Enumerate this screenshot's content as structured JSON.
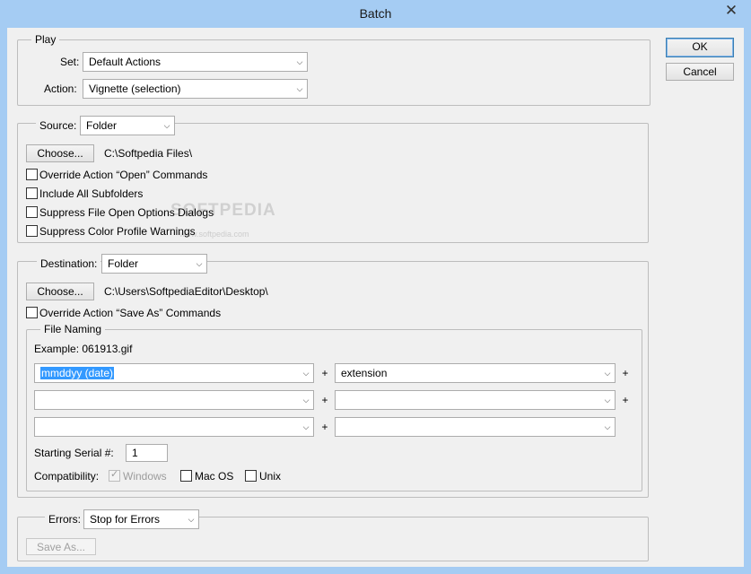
{
  "window": {
    "title": "Batch",
    "close_glyph": "✕"
  },
  "buttons": {
    "ok": "OK",
    "cancel": "Cancel"
  },
  "play": {
    "legend": "Play",
    "set_label": "Set:",
    "set_value": "Default Actions",
    "action_label": "Action:",
    "action_value": "Vignette (selection)"
  },
  "source": {
    "label": "Source:",
    "value": "Folder",
    "choose_label": "Choose...",
    "path": "C:\\Softpedia Files\\",
    "options": [
      "Override Action “Open” Commands",
      "Include All Subfolders",
      "Suppress File Open Options Dialogs",
      "Suppress Color Profile Warnings"
    ]
  },
  "destination": {
    "label": "Destination:",
    "value": "Folder",
    "choose_label": "Choose...",
    "path": "C:\\Users\\SoftpediaEditor\\Desktop\\",
    "override_save_as": "Override Action “Save As” Commands"
  },
  "file_naming": {
    "legend": "File Naming",
    "example": "Example: 061913.gif",
    "fields": [
      "mmddyy (date)",
      "extension",
      "",
      "",
      "",
      ""
    ],
    "plus": "+",
    "serial_label": "Starting Serial #:",
    "serial_value": "1",
    "compat_label": "Compatibility:",
    "compat_windows": "Windows",
    "compat_mac": "Mac OS",
    "compat_unix": "Unix"
  },
  "errors": {
    "label": "Errors:",
    "value": "Stop for Errors",
    "save_as_label": "Save As..."
  },
  "icons": {
    "dropdown": "chevron-down-icon",
    "checkbox_tick": "✓"
  },
  "colors": {
    "titlebar": "#a5ccf3",
    "selection": "#3399ff",
    "default_button_border": "#3c7fb1"
  },
  "watermark": {
    "text": "SOFTPEDIA",
    "sub": "www.softpedia.com"
  }
}
